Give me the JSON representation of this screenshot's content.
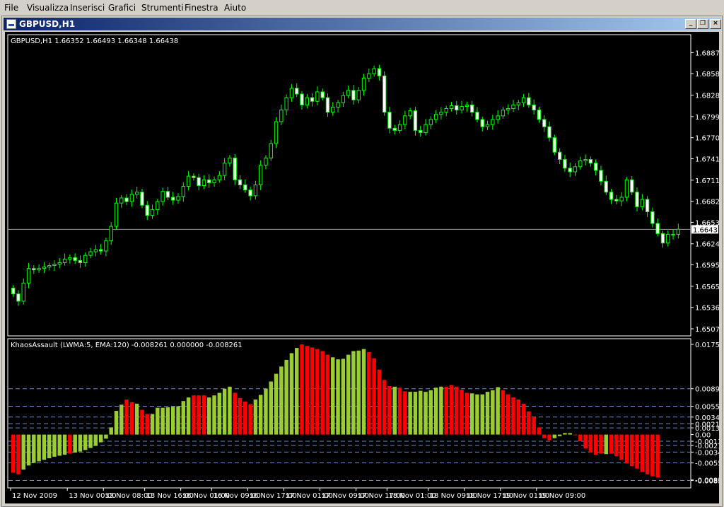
{
  "menu": {
    "items": [
      {
        "label": "File"
      },
      {
        "label": "Visualizza"
      },
      {
        "label": "Inserisci"
      },
      {
        "label": "Grafici"
      },
      {
        "label": "Strumenti"
      },
      {
        "label": "Finestra"
      },
      {
        "label": "Aiuto"
      }
    ]
  },
  "window": {
    "title": "GBPUSD,H1",
    "buttons": {
      "minimize": "_",
      "restore": "❐",
      "close": "×"
    }
  },
  "colors": {
    "background": "#000000",
    "candle": "#00ff00",
    "bull_fill": "#000000",
    "bear_fill": "#ffffff",
    "up_bar": "#9acd32",
    "down_bar": "#ff0000",
    "level_line": "#6a8ccf"
  },
  "price_panel": {
    "info": "GBPUSD,H1  1.66352 1.66493 1.66348 1.66438",
    "current_price": "1.66438",
    "y_labels": [
      "1.68870",
      "1.68580",
      "1.68285",
      "1.67990",
      "1.67700",
      "1.67410",
      "1.67115",
      "1.66825",
      "1.66535",
      "1.66240",
      "1.65950",
      "1.65655",
      "1.65365",
      "1.65070"
    ]
  },
  "indicator_panel": {
    "info": "KhaosAssault (LWMA:5, EMA:120) -0.008261 0.000000 -0.008261",
    "y_labels": [
      "0.017506",
      "0.0089",
      "0.0055",
      "0.0034",
      "0.0021",
      "0.0013",
      "0.00",
      "-0.0013",
      "-0.0021",
      "-0.0034",
      "-0.0055",
      "-0.0089",
      "-0.008261"
    ],
    "levels": [
      0.0089,
      0.0055,
      0.0034,
      0.0021,
      0.0013,
      -0.0013,
      -0.0021,
      -0.0034,
      -0.0055,
      -0.0089
    ]
  },
  "x_labels": [
    "12 Nov 2009",
    "13 Nov 00:00",
    "13 Nov 08:00",
    "13 Nov 16:00",
    "16 Nov 01:00",
    "16 Nov 09:00",
    "16 Nov 17:00",
    "17 Nov 01:00",
    "17 Nov 09:00",
    "17 Nov 17:00",
    "18 Nov 01:00",
    "18 Nov 09:00",
    "18 Nov 17:00",
    "19 Nov 01:00",
    "19 Nov 09:00"
  ],
  "chart_data": [
    {
      "type": "candlestick",
      "title": "GBPUSD,H1",
      "ylim": [
        1.6507,
        1.6902
      ],
      "close_series": [
        1.6555,
        1.6545,
        1.657,
        1.659,
        1.6588,
        1.659,
        1.6592,
        1.6594,
        1.6596,
        1.6598,
        1.6603,
        1.6605,
        1.6601,
        1.6598,
        1.6608,
        1.6613,
        1.6616,
        1.6614,
        1.6628,
        1.6648,
        1.668,
        1.6687,
        1.6682,
        1.6692,
        1.6695,
        1.6677,
        1.6663,
        1.6671,
        1.6682,
        1.6696,
        1.6688,
        1.6684,
        1.6689,
        1.6703,
        1.6717,
        1.6715,
        1.6704,
        1.6712,
        1.6708,
        1.6712,
        1.6718,
        1.6735,
        1.6742,
        1.6712,
        1.6705,
        1.6698,
        1.669,
        1.6705,
        1.6732,
        1.6742,
        1.6762,
        1.6792,
        1.6808,
        1.6825,
        1.6838,
        1.683,
        1.6815,
        1.6825,
        1.682,
        1.6833,
        1.6825,
        1.6805,
        1.6812,
        1.6818,
        1.6828,
        1.6835,
        1.6822,
        1.6835,
        1.6852,
        1.6858,
        1.6865,
        1.6855,
        1.6805,
        1.6783,
        1.678,
        1.6788,
        1.68,
        1.6807,
        1.678,
        1.6777,
        1.6788,
        1.6795,
        1.6802,
        1.6805,
        1.681,
        1.6814,
        1.6808,
        1.6813,
        1.6815,
        1.6805,
        1.6795,
        1.6785,
        1.6788,
        1.6795,
        1.68,
        1.6808,
        1.681,
        1.6815,
        1.6818,
        1.6825,
        1.6815,
        1.6808,
        1.6795,
        1.6785,
        1.677,
        1.675,
        1.674,
        1.6728,
        1.6723,
        1.673,
        1.6738,
        1.674,
        1.6735,
        1.6725,
        1.671,
        1.6695,
        1.6685,
        1.6683,
        1.6688,
        1.6712,
        1.6695,
        1.6675,
        1.6685,
        1.6668,
        1.6652,
        1.6638,
        1.6625,
        1.6637,
        1.6637,
        1.6644
      ],
      "series": [
        {
          "name": "KhaosAssault",
          "values": [
            -0.0074,
            -0.0077,
            -0.0068,
            -0.006,
            -0.0055,
            -0.0052,
            -0.0049,
            -0.0046,
            -0.0043,
            -0.0041,
            -0.0039,
            -0.0037,
            -0.0035,
            -0.0033,
            -0.003,
            -0.0026,
            -0.0022,
            -0.0015,
            -0.0008,
            0.0014,
            0.0046,
            0.0058,
            0.0068,
            0.0063,
            0.006,
            0.0048,
            0.004,
            0.004,
            0.0052,
            0.0052,
            0.0053,
            0.0054,
            0.0055,
            0.0065,
            0.0072,
            0.0076,
            0.0076,
            0.0076,
            0.0072,
            0.0076,
            0.0081,
            0.0089,
            0.0093,
            0.0081,
            0.0071,
            0.0064,
            0.0059,
            0.0068,
            0.0077,
            0.0089,
            0.0103,
            0.0118,
            0.0132,
            0.0145,
            0.0158,
            0.0168,
            0.0175,
            0.0172,
            0.0169,
            0.0166,
            0.0162,
            0.0155,
            0.015,
            0.0146,
            0.0147,
            0.0155,
            0.0162,
            0.0163,
            0.0166,
            0.016,
            0.0148,
            0.0126,
            0.0106,
            0.0094,
            0.0093,
            0.0091,
            0.0084,
            0.0083,
            0.0083,
            0.0085,
            0.0083,
            0.0086,
            0.0091,
            0.0093,
            0.0093,
            0.0096,
            0.0093,
            0.0087,
            0.0081,
            0.008,
            0.0078,
            0.0078,
            0.0083,
            0.0086,
            0.0092,
            0.0086,
            0.0078,
            0.0072,
            0.0068,
            0.006,
            0.0045,
            0.0034,
            0.0014,
            -0.0007,
            -0.0011,
            -0.0007,
            -0.0003,
            0.0003,
            0.0003,
            0.0,
            -0.0013,
            -0.0027,
            -0.0035,
            -0.0039,
            -0.0037,
            -0.0038,
            -0.0037,
            -0.0042,
            -0.0049,
            -0.0056,
            -0.0061,
            -0.0066,
            -0.0072,
            -0.0077,
            -0.0081,
            -0.0083
          ],
          "colors": [
            "r",
            "r",
            "g",
            "g",
            "g",
            "g",
            "g",
            "g",
            "g",
            "g",
            "g",
            "r",
            "g",
            "g",
            "g",
            "g",
            "g",
            "g",
            "g",
            "g",
            "g",
            "g",
            "r",
            "r",
            "g",
            "r",
            "r",
            "g",
            "g",
            "g",
            "g",
            "g",
            "g",
            "g",
            "g",
            "r",
            "r",
            "r",
            "g",
            "g",
            "g",
            "g",
            "g",
            "r",
            "r",
            "r",
            "r",
            "g",
            "g",
            "g",
            "g",
            "g",
            "g",
            "g",
            "g",
            "g",
            "r",
            "r",
            "r",
            "r",
            "r",
            "r",
            "g",
            "g",
            "g",
            "g",
            "g",
            "g",
            "g",
            "r",
            "r",
            "r",
            "r",
            "r",
            "g",
            "r",
            "r",
            "g",
            "g",
            "g",
            "g",
            "g",
            "g",
            "g",
            "r",
            "r",
            "r",
            "r",
            "r",
            "g",
            "g",
            "g",
            "g",
            "g",
            "g",
            "r",
            "r",
            "r",
            "r",
            "r",
            "r",
            "r",
            "r",
            "r",
            "r",
            "g",
            "g",
            "g",
            "g",
            "r",
            "r",
            "r",
            "r",
            "r",
            "r",
            "g",
            "r",
            "r",
            "r",
            "r",
            "r",
            "r",
            "r",
            "r",
            "r"
          ]
        }
      ]
    }
  ]
}
